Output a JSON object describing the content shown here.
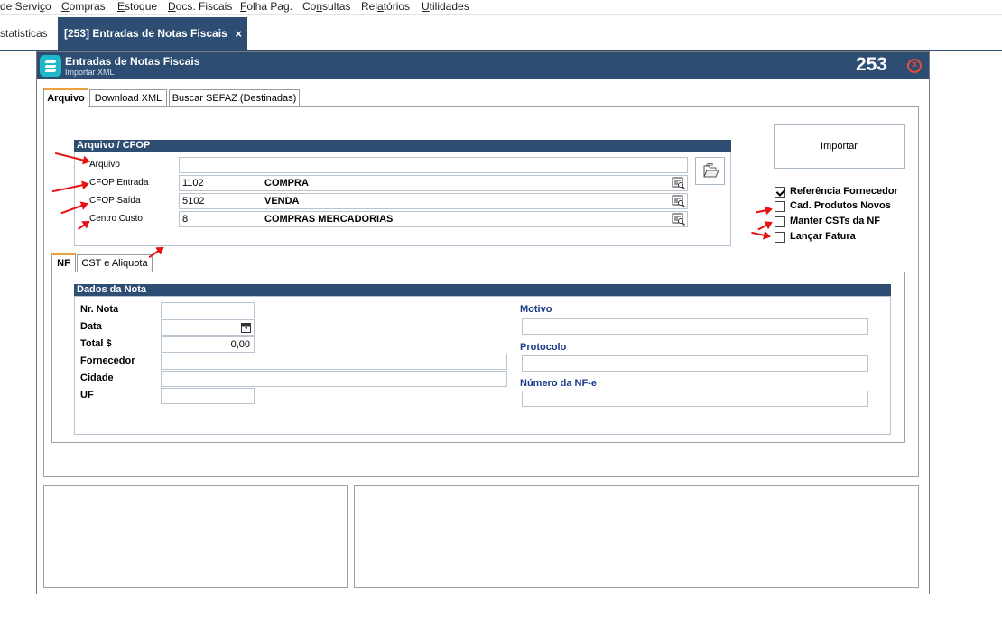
{
  "menubar": {
    "items": [
      {
        "pre": "de Servi",
        "u": "ç",
        "post": "o"
      },
      {
        "pre": "",
        "u": "C",
        "post": "ompras"
      },
      {
        "pre": "",
        "u": "E",
        "post": "stoque"
      },
      {
        "pre": "",
        "u": "D",
        "post": "ocs. Fiscais"
      },
      {
        "pre": "",
        "u": "F",
        "post": "olha Pag."
      },
      {
        "pre": "Co",
        "u": "n",
        "post": "sultas"
      },
      {
        "pre": "Rel",
        "u": "a",
        "post": "tórios"
      },
      {
        "pre": "",
        "u": "U",
        "post": "tilidades"
      }
    ]
  },
  "tabs": {
    "inactive_label": "statisticas",
    "active_label": "[253] Entradas de Notas Fiscais",
    "close_glyph": "×"
  },
  "window": {
    "title": "Entradas de Notas Fiscais",
    "subtitle": "Importar XML",
    "number": "253",
    "close_glyph": "×"
  },
  "main_tabs": [
    "Arquivo",
    "Download XML",
    "Buscar SEFAZ (Destinadas)"
  ],
  "arquivo_group": {
    "header": "Arquivo / CFOP",
    "labels": {
      "arquivo": "Arquivo",
      "cfop_entrada": "CFOP Entrada",
      "cfop_saida": "CFOP Saída",
      "centro_custo": "Centro Custo"
    },
    "values": {
      "arquivo": "",
      "cfop_entrada_code": "1102",
      "cfop_entrada_desc": "COMPRA",
      "cfop_saida_code": "5102",
      "cfop_saida_desc": "VENDA",
      "centro_custo_code": "8",
      "centro_custo_desc": "COMPRAS MERCADORIAS"
    }
  },
  "import_button": "Importar",
  "options": [
    {
      "label": "Referência Fornecedor",
      "checked": true
    },
    {
      "label": "Cad. Produtos Novos",
      "checked": false
    },
    {
      "label": "Manter CSTs da NF",
      "checked": false
    },
    {
      "label": "Lançar Fatura",
      "checked": false
    }
  ],
  "sub_tabs": [
    "NF",
    "CST e Aliquota"
  ],
  "dados_nota": {
    "header": "Dados da Nota",
    "labels": {
      "nr_nota": "Nr. Nota",
      "data": "Data",
      "total": "Total $",
      "fornecedor": "Fornecedor",
      "cidade": "Cidade",
      "uf": "UF",
      "motivo": "Motivo",
      "protocolo": "Protocolo",
      "numero_nfe": "Número da NF-e"
    },
    "values": {
      "nr_nota": "",
      "data": "",
      "total": "0,00",
      "fornecedor": "",
      "cidade": "",
      "uf": "",
      "motivo": "",
      "protocolo": "",
      "numero_nfe": ""
    },
    "calendar_day": "7"
  },
  "colors": {
    "navy": "#2d4d73",
    "accent_tab": "#e8a33b",
    "arrow": "#e81010",
    "close": "#e74c3c",
    "logo": "#1fb8c9"
  }
}
